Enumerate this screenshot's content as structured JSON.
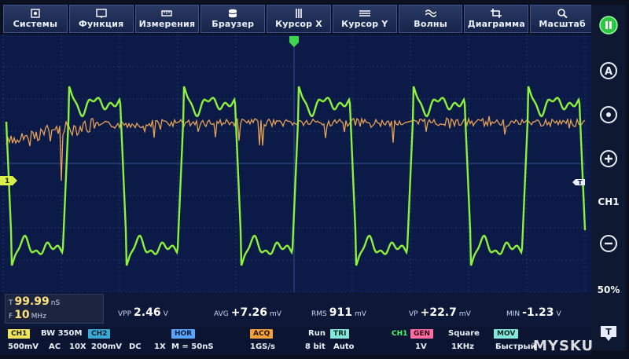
{
  "menu": [
    {
      "label": "Системы",
      "icon": "gear-icon"
    },
    {
      "label": "Функция",
      "icon": "function-icon"
    },
    {
      "label": "Измерения",
      "icon": "ruler-icon"
    },
    {
      "label": "Браузер",
      "icon": "database-icon"
    },
    {
      "label": "Курсор X",
      "icon": "cursor-x-icon"
    },
    {
      "label": "Курсор Y",
      "icon": "cursor-y-icon"
    },
    {
      "label": "Волны",
      "icon": "wave-icon"
    },
    {
      "label": "Диаграмма",
      "icon": "crop-icon"
    },
    {
      "label": "Масштаб",
      "icon": "zoom-icon"
    }
  ],
  "sidebar": {
    "run_state": "run-pause-icon",
    "auto": "auto-icon",
    "target": "target-icon",
    "plus": "plus-icon",
    "channel": "CH1",
    "minus": "minus-icon",
    "duty": "50%",
    "trigger": "trigger-icon"
  },
  "markers": {
    "ch1_level": "1",
    "trigger_right": "T"
  },
  "counter": {
    "period_tag": "T",
    "period_value": "99.99",
    "period_unit": "nS",
    "freq_tag": "F",
    "freq_value": "10",
    "freq_unit": "MHz"
  },
  "measurements": [
    {
      "name": "VPP",
      "value": "2.46",
      "unit": "V"
    },
    {
      "name": "AVG",
      "value": "+7.26",
      "unit": "mV"
    },
    {
      "name": "RMS",
      "value": "911",
      "unit": "mV"
    },
    {
      "name": "VP",
      "value": "+22.7",
      "unit": "mV"
    },
    {
      "name": "MIN",
      "value": "-1.23",
      "unit": "V"
    }
  ],
  "status": {
    "ch1_chip": "CH1",
    "bw": "BW 350M",
    "ch2_chip": "CH2",
    "ch1_scale": "500mV",
    "ch1_coupling": "AC",
    "ch1_probe": "10X",
    "ch2_scale": "200mV",
    "ch2_coupling": "DC",
    "ch2_probe": "1X",
    "hor_chip": "HOR",
    "hor_value": "M = 50nS",
    "acq_chip": "ACQ",
    "acq_value": "1GS/s",
    "run": "Run",
    "bits": "8 bit",
    "tri_chip": "TRI",
    "tri_value": "Auto",
    "tri_ch": "CH1",
    "gen_chip": "GEN",
    "gen_value": "1V",
    "square": "Square",
    "freq": "1KHz",
    "mov_chip": "MOV",
    "mov_value": "Быстрый"
  },
  "watermark": "MYSKU",
  "colors": {
    "ch1": "#8cf23c",
    "ch2": "#ffb15a",
    "grid": "#2a3f7a",
    "background": "#0b1a46"
  },
  "chart_data": {
    "type": "line",
    "series": [
      {
        "name": "CH1",
        "waveform": "square-with-ringing",
        "period_ns": 99.99,
        "frequency_mhz": 10,
        "vpp_v": 2.46,
        "min_v": -1.23
      },
      {
        "name": "CH2",
        "waveform": "noisy-decaying",
        "scale": "200mV"
      }
    ],
    "grid": true
  }
}
